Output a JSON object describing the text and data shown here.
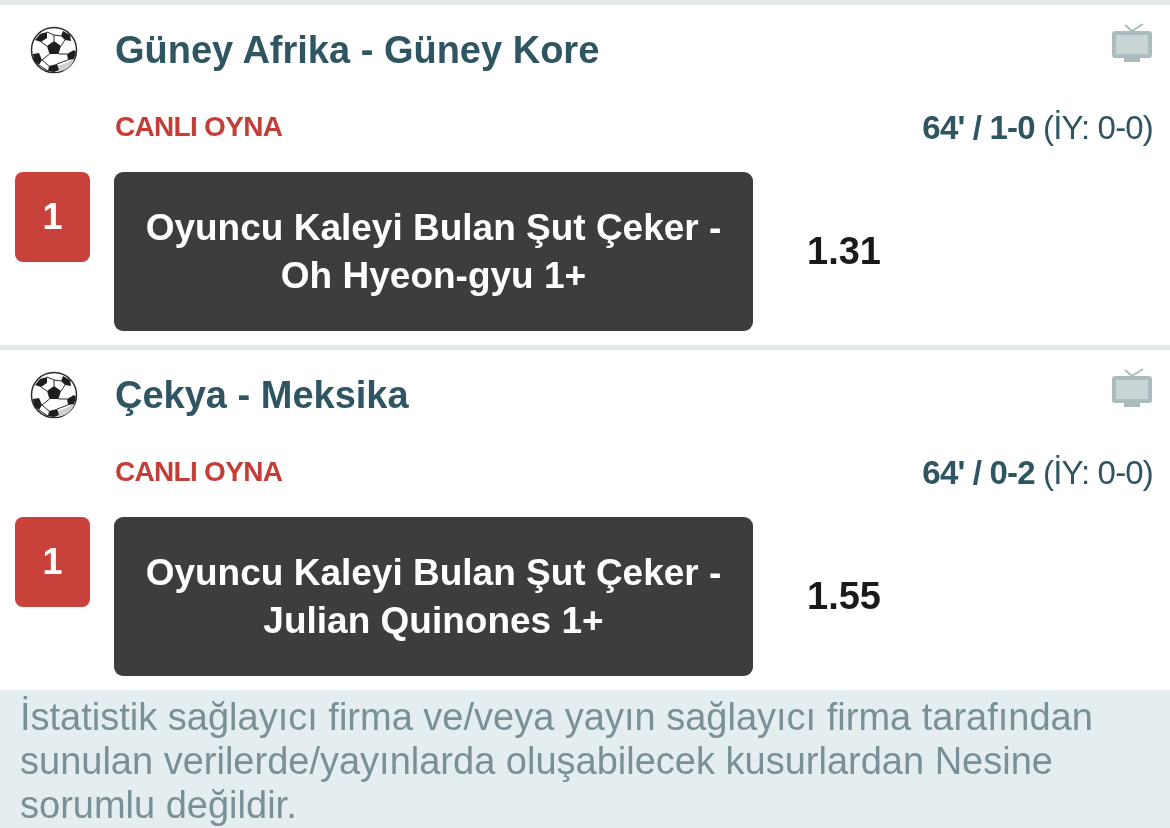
{
  "matches": [
    {
      "title": "Güney Afrika - Güney Kore",
      "live_label": "CANLI OYNA",
      "score": "**64' / 1-0** (İY: 0-0)",
      "tv_available": true,
      "selection": {
        "outcome": "1",
        "market": "Oyuncu Kaleyi Bulan Şut Çeker - Oh Hyeon-gyu 1+",
        "odds": "1.31"
      }
    },
    {
      "title": "Çekya - Meksika",
      "live_label": "CANLI OYNA",
      "score": "**64' / 0-2** (İY: 0-0)",
      "tv_available": true,
      "selection": {
        "outcome": "1",
        "market": "Oyuncu Kaleyi Bulan Şut Çeker - Julian Quinones 1+",
        "odds": "1.55"
      }
    }
  ],
  "disclaimer": "İstatistik sağlayıcı firma ve/veya yayın sağlayıcı firma tarafından sunulan verilerde/yayınlarda oluşabilecek kusurlardan Nesine sorumlu değildir."
}
